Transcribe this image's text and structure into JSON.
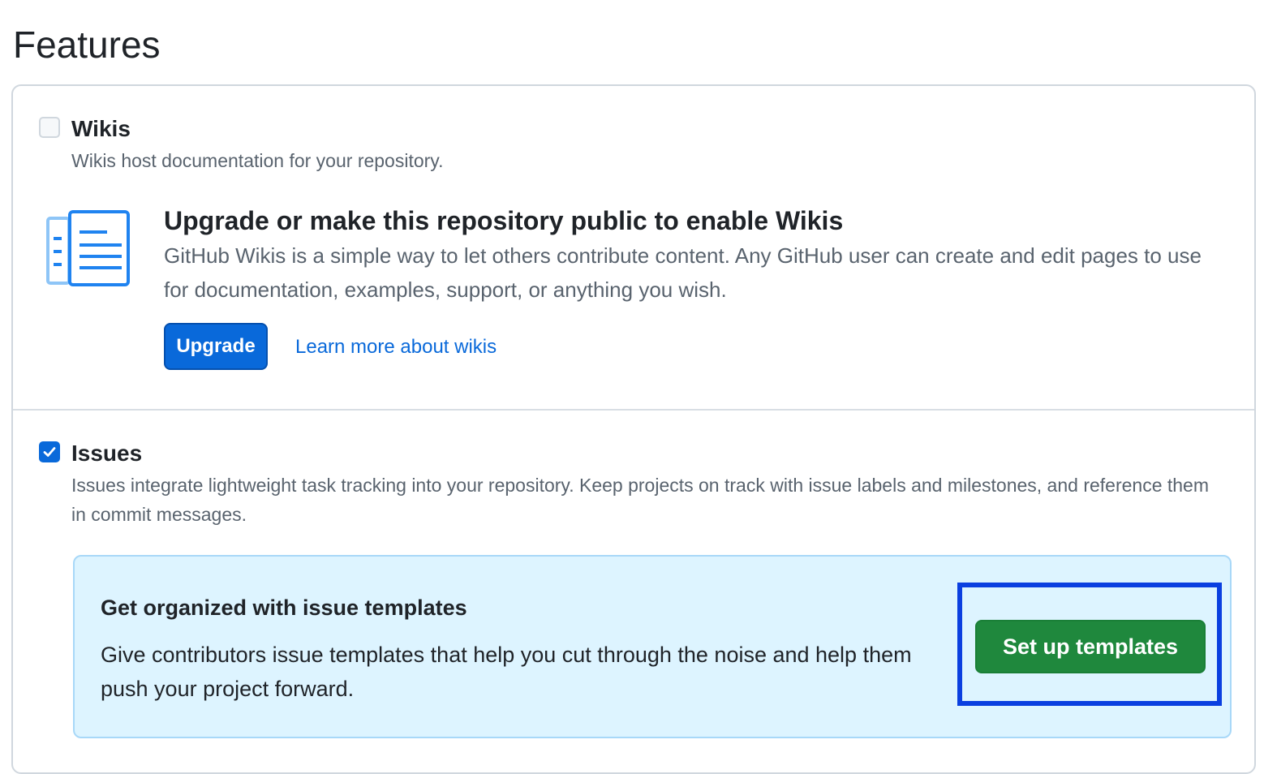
{
  "page": {
    "title": "Features"
  },
  "wikis": {
    "checked": false,
    "title": "Wikis",
    "description": "Wikis host documentation for your repository.",
    "upsell": {
      "icon": "book-list-icon",
      "title": "Upgrade or make this repository public to enable Wikis",
      "description": "GitHub Wikis is a simple way to let others contribute content. Any GitHub user can create and edit pages to use for documentation, examples, support, or anything you wish.",
      "upgrade_label": "Upgrade",
      "learn_more_label": "Learn more about wikis"
    }
  },
  "issues": {
    "checked": true,
    "title": "Issues",
    "description": "Issues integrate lightweight task tracking into your repository. Keep projects on track with issue labels and milestones, and reference them in commit messages.",
    "templates": {
      "title": "Get organized with issue templates",
      "description": "Give contributors issue templates that help you cut through the noise and help them push your project forward.",
      "button_label": "Set up templates"
    }
  },
  "colors": {
    "primary_blue": "#0969da",
    "green_button": "#1f883d",
    "info_background": "#ddf4ff",
    "highlight_frame": "#0a3fe0"
  }
}
